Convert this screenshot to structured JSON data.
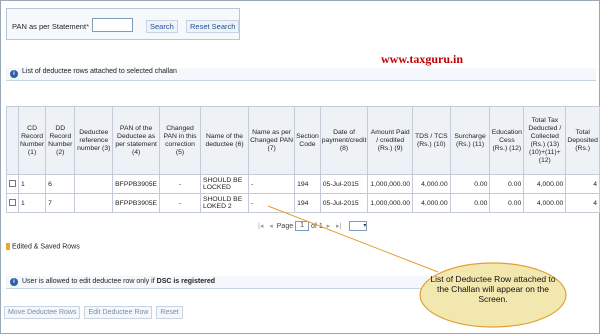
{
  "search": {
    "label": "PAN as per Statement",
    "required_mark": "*",
    "input_value": "",
    "search_button": "Search",
    "reset_button": "Reset Search"
  },
  "watermark": "www.taxguru.in",
  "info_bar": {
    "icon": "info-icon",
    "text": "List of deductee rows attached to selected challan"
  },
  "table": {
    "headers": [
      "",
      "CD Record Number (1)",
      "DD Record Number (2)",
      "Deductee reference number (3)",
      "PAN of the Deductee as per statement (4)",
      "Changed PAN in this correction (5)",
      "Name of the deductee (6)",
      "Name as per Changed PAN (7)",
      "Section Code",
      "Date of payment/credit (8)",
      "Amount Paid / credited (Rs.) (9)",
      "TDS / TCS (Rs.) (10)",
      "Surcharge (Rs.) (11)",
      "Education Cess (Rs.) (12)",
      "Total Tax Deducted / Collected (Rs.) (13) (10)+(11)+(12)",
      "Total Deposited (Rs.)"
    ],
    "rows": [
      {
        "cd": "1",
        "dd": "6",
        "ref": "",
        "pan": "BFPPB3905E",
        "changed_pan": "-",
        "name": "SHOULD BE LOCKED",
        "changed_name": "-",
        "section": "194",
        "date": "05-Jul-2015",
        "amount": "1,000,000.00",
        "tds": "4,000.00",
        "surcharge": "0.00",
        "cess": "0.00",
        "total": "4,000.00",
        "deposited": "4"
      },
      {
        "cd": "1",
        "dd": "7",
        "ref": "",
        "pan": "BFPPB3905E",
        "changed_pan": "-",
        "name": "SHOULD BE LOKED 2",
        "changed_name": "-",
        "section": "194",
        "date": "05-Jul-2015",
        "amount": "1,000,000.00",
        "tds": "4,000.00",
        "surcharge": "0.00",
        "cess": "0.00",
        "total": "4,000.00",
        "deposited": "4"
      }
    ]
  },
  "pager": {
    "page_label": "Page",
    "page_value": "1",
    "of_label": "of 1"
  },
  "legend": {
    "text": "Edited & Saved Rows",
    "color": "#f3a330"
  },
  "note": {
    "prefix": "User is allowed to edit deductee row only if",
    "bold": "DSC is registered"
  },
  "buttons": {
    "move": "Move Deductee Rows",
    "edit": "Edit Deductee Row",
    "reset": "Reset"
  },
  "callout": {
    "text": "List of Deductee Row attached to the Challan will appear on the Screen.",
    "color": "#f3e7b0"
  }
}
